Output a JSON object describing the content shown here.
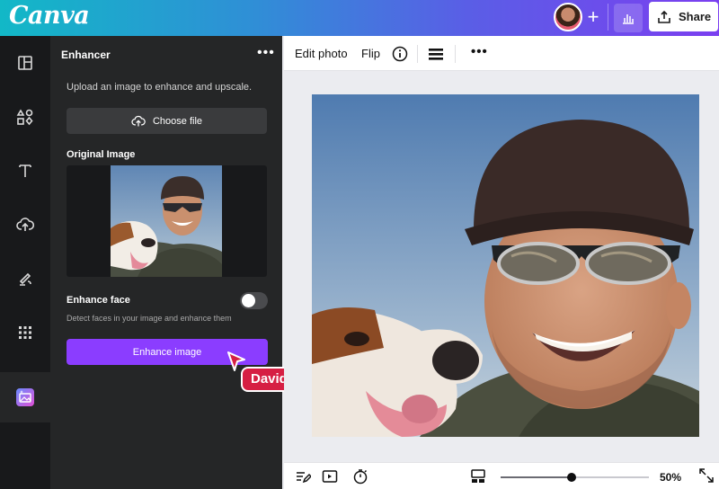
{
  "app": {
    "logo_text": "Canva"
  },
  "header": {
    "share_label": "Share",
    "add_label": "+"
  },
  "panel": {
    "title": "Enhancer",
    "more_label": "•••",
    "description": "Upload an image to enhance and upscale.",
    "choose_file_label": "Choose file",
    "original_image_label": "Original Image",
    "enhance_face_label": "Enhance face",
    "enhance_face_enabled": false,
    "enhance_face_description": "Detect faces in your image and enhance them",
    "enhance_button_label": "Enhance image"
  },
  "collaborator": {
    "name": "David",
    "color": "#d61f43"
  },
  "toolbar": {
    "edit_photo_label": "Edit photo",
    "flip_label": "Flip",
    "more_label": "•••"
  },
  "rail": {
    "items": [
      "templates-icon",
      "elements-icon",
      "text-icon",
      "uploads-icon",
      "draw-icon",
      "apps-icon",
      "enhancer-app-icon"
    ],
    "active": "enhancer-app-icon"
  },
  "bottombar": {
    "zoom_label": "50%",
    "zoom_level": 0.5
  },
  "colors": {
    "accent": "#8b3dff",
    "rail_bg": "#18191b",
    "panel_bg": "#252627"
  }
}
